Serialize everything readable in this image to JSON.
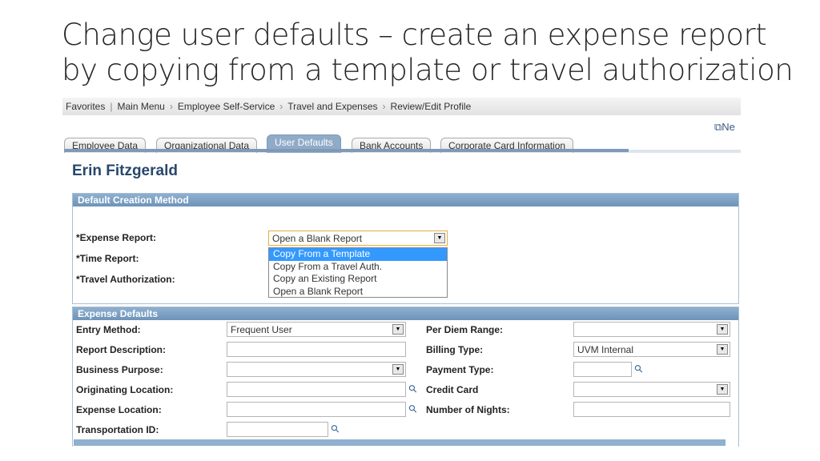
{
  "slide_title": [
    "Change user defaults – create an expense report",
    "by copying from a template or travel authorization"
  ],
  "breadcrumb": [
    "Favorites",
    "Main Menu",
    "Employee Self-Service",
    "Travel and Expenses",
    "Review/Edit Profile"
  ],
  "new_window_label": "Ne",
  "tabs": [
    "Employee Data",
    "Organizational Data",
    "User Defaults",
    "Bank Accounts",
    "Corporate Card Information"
  ],
  "active_tab": "User Defaults",
  "employee_name": "Erin Fitzgerald",
  "default_creation": {
    "header": "Default Creation Method",
    "expense_report_label": "*Expense Report:",
    "expense_report_value": "Open a Blank Report",
    "time_report_label": "*Time Report:",
    "travel_auth_label": "*Travel Authorization:",
    "options": [
      "Copy From a Template",
      "Copy From a Travel Auth.",
      "Copy an Existing Report",
      "Open a Blank Report"
    ],
    "highlighted_option": "Copy From a Template"
  },
  "expense_defaults": {
    "header": "Expense Defaults",
    "left": [
      {
        "label": "Entry Method:",
        "value": "Frequent User",
        "type": "select"
      },
      {
        "label": "Report Description:",
        "value": "",
        "type": "text"
      },
      {
        "label": "Business Purpose:",
        "value": "",
        "type": "select"
      },
      {
        "label": "Originating Location:",
        "value": "",
        "type": "lookup"
      },
      {
        "label": "Expense Location:",
        "value": "",
        "type": "lookup"
      },
      {
        "label": "Transportation ID:",
        "value": "",
        "type": "lookup-short"
      }
    ],
    "right": [
      {
        "label": "Per Diem Range:",
        "value": "",
        "type": "select"
      },
      {
        "label": "Billing Type:",
        "value": "UVM Internal",
        "type": "select"
      },
      {
        "label": "Payment Type:",
        "value": "",
        "type": "lookup-short"
      },
      {
        "label": "Credit Card",
        "value": "",
        "type": "select"
      },
      {
        "label": "Number of Nights:",
        "value": "",
        "type": "text"
      }
    ]
  }
}
